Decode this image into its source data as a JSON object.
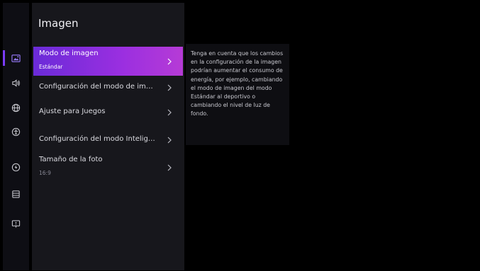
{
  "panel": {
    "title": "Imagen",
    "items": [
      {
        "label": "Modo de imagen",
        "value": "Estándar",
        "selected": true
      },
      {
        "label": "Configuración del modo de im…"
      },
      {
        "label": "Ajuste para Juegos"
      },
      {
        "label": "Configuración del modo Intelig…"
      },
      {
        "label": "Tamaño de la foto",
        "value": "16:9"
      }
    ]
  },
  "info": {
    "text": "Tenga en cuenta que los cambios en la configuración de la imagen podrían aumentar el consumo de energía, por ejemplo, cambiando el modo de imagen del modo Estándar al deportivo o cambiando el nivel de luz de fondo."
  },
  "sidebar": {
    "icons": [
      "picture-icon",
      "sound-icon",
      "network-icon",
      "accessibility-icon",
      "power-icon",
      "system-icon",
      "support-icon"
    ],
    "active_index": 0
  },
  "colors": {
    "accent": "#7b3cff",
    "selected_gradient_start": "#6a2bd8",
    "selected_gradient_end": "#b63bd6"
  }
}
